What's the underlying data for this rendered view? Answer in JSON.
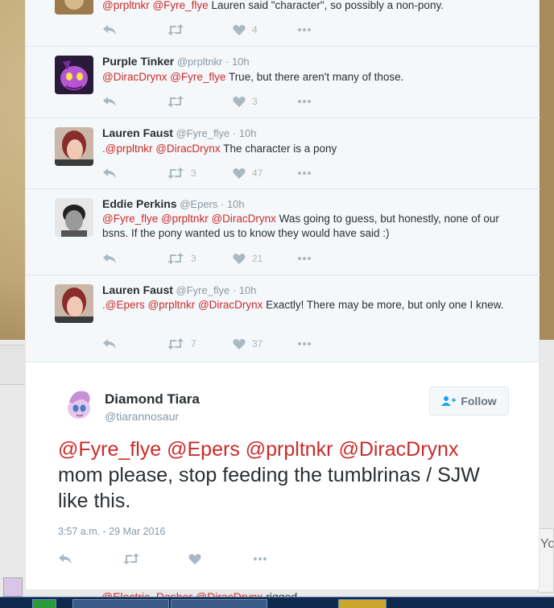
{
  "timeline": {
    "tweets": [
      {
        "name": "",
        "handle": "",
        "time": "",
        "text_mentions": "@prpltnkr @Fyre_flye",
        "text_body": " Lauren said \"character\", so possibly a non-pony.",
        "retweets": "",
        "likes": "4"
      },
      {
        "name": "Purple Tinker",
        "handle": "@prpltnkr",
        "time": "· 10h",
        "text_mentions": "@DiracDrynx @Fyre_flye",
        "text_body": " True, but there aren't many of those.",
        "retweets": "",
        "likes": "3"
      },
      {
        "name": "Lauren Faust",
        "handle": "@Fyre_flye",
        "time": "· 10h",
        "text_mentions": ".@prpltnkr @DiracDrynx",
        "text_body": " The character is a pony",
        "retweets": "3",
        "likes": "47"
      },
      {
        "name": "Eddie Perkins",
        "handle": "@Epers",
        "time": "· 10h",
        "text_mentions": "@Fyre_flye @prpltnkr @DiracDrynx",
        "text_body": " Was going to guess, but honestly, none of our bsns. If the pony wanted us to know they would have said :)",
        "retweets": "3",
        "likes": "21"
      },
      {
        "name": "Lauren Faust",
        "handle": "@Fyre_flye",
        "time": "· 10h",
        "text_mentions": ".@Epers @prpltnkr @DiracDrynx",
        "text_body": " Exactly!  There may be more, but only one I knew.",
        "retweets": "7",
        "likes": "37"
      }
    ]
  },
  "expanded": {
    "display_name": "Diamond Tiara",
    "handle": "@tiarannosaur",
    "follow_label": "Follow",
    "mentions": "@Fyre_flye @Epers @prpltnkr @DiracDrynx",
    "body": "mom please, stop feeding the tumblrinas / SJW like this.",
    "timestamp": "3:57 a.m. - 29 Mar 2016"
  },
  "under": {
    "text_mentions": "@Electric_Dasher @DiracDrynx",
    "text_body": " rigged."
  },
  "side": {
    "right_tab_text": "Yo"
  },
  "colors": {
    "mention": "#cc2a2a",
    "muted": "#8899a6",
    "text": "#292f33",
    "icon": "#aab8c2"
  },
  "icons": [
    "reply-icon",
    "retweet-icon",
    "heart-icon",
    "more-icon",
    "add-user-icon"
  ]
}
